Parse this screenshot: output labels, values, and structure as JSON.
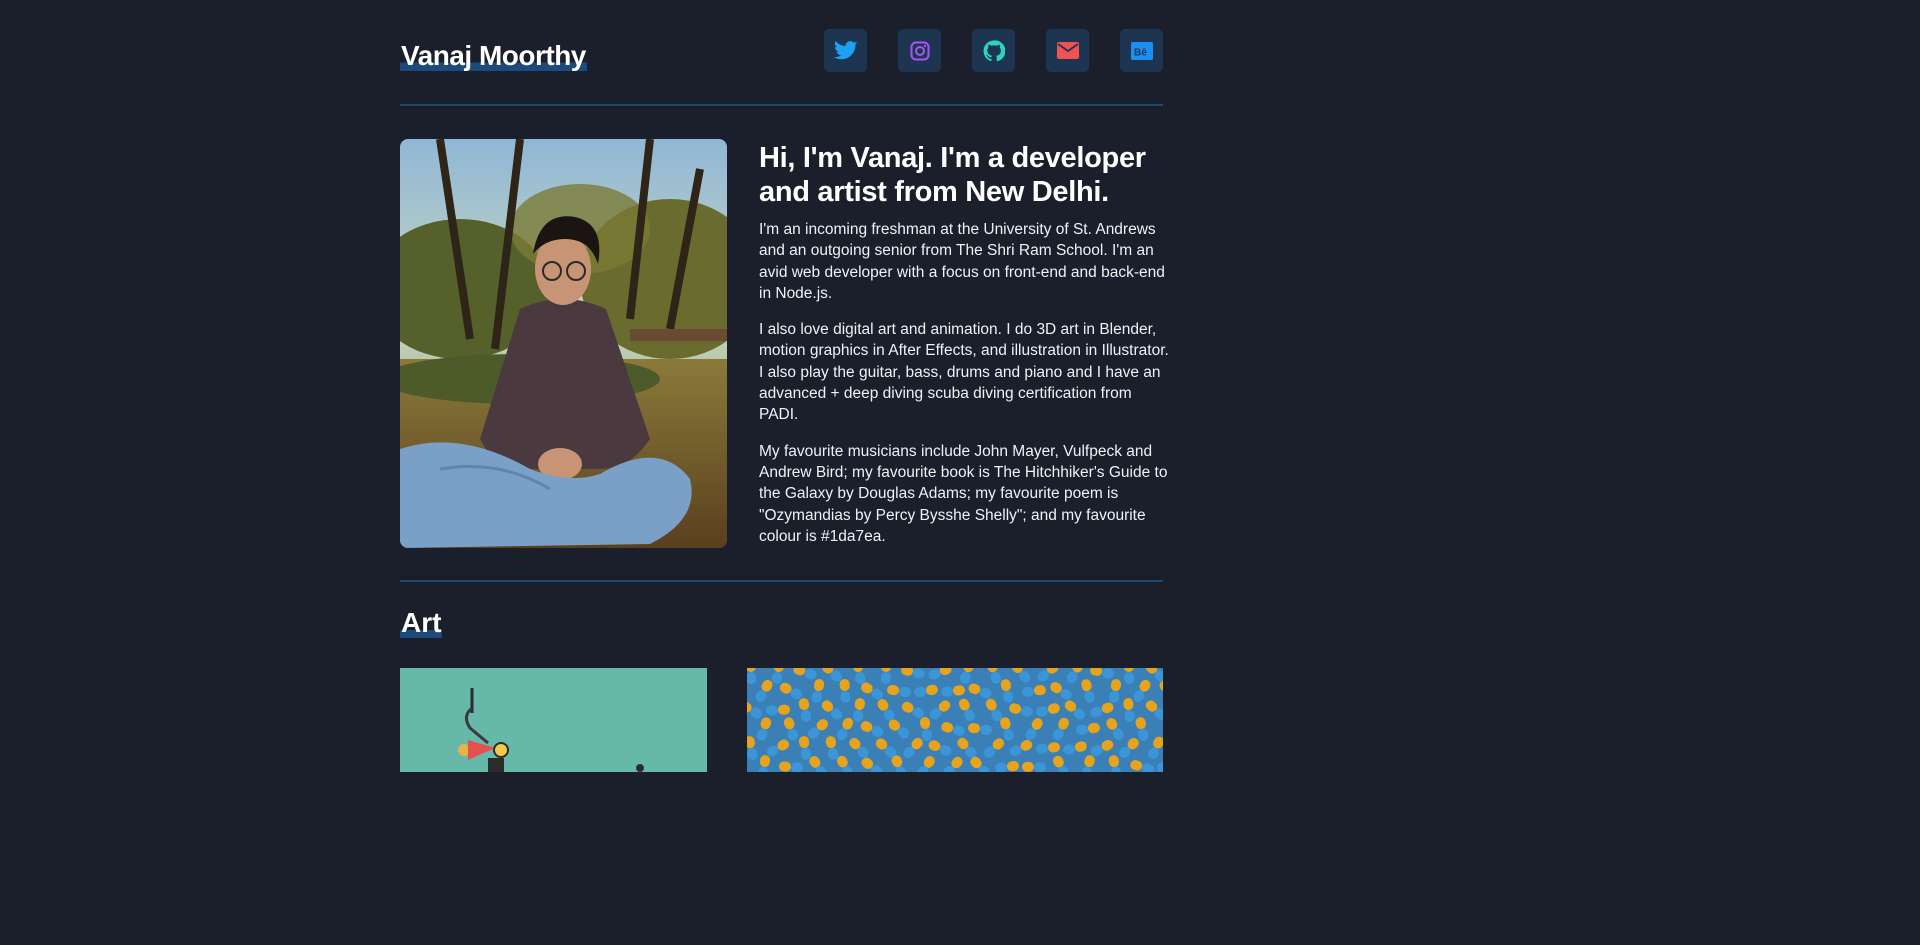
{
  "site": {
    "title": "Vanaj Moorthy"
  },
  "socials": [
    {
      "name": "twitter",
      "icon": "twitter-icon",
      "color": "#1da1f2"
    },
    {
      "name": "instagram",
      "icon": "instagram-icon",
      "color": "#a855f7"
    },
    {
      "name": "github",
      "icon": "github-icon",
      "color": "#2dd4bf"
    },
    {
      "name": "email",
      "icon": "envelope-icon",
      "color": "#f05252"
    },
    {
      "name": "behance",
      "icon": "behance-icon",
      "color": "#1d8ff0"
    }
  ],
  "about": {
    "heading": "Hi, I'm Vanaj. I'm a developer and artist from New Delhi.",
    "paragraphs": [
      "I'm an incoming freshman at the University of St. Andrews and an outgoing senior from The Shri Ram School. I'm an avid web developer with a focus on front-end and back-end in Node.js.",
      "I also love digital art and animation. I do 3D art in Blender, motion graphics in After Effects, and illustration in Illustrator. I also play the guitar, bass, drums and piano and I have an advanced + deep diving scuba diving certification from PADI.",
      "My favourite musicians include John Mayer, Vulfpeck and Andrew Bird; my favourite book is The Hitchhiker's Guide to the Galaxy by Douglas Adams; my favourite poem is \"Ozymandias by Percy Bysshe Shelly\"; and my favourite colour is #1da7ea."
    ]
  },
  "art": {
    "title": "Art"
  },
  "colors": {
    "background": "#1a1f2b",
    "divider": "#1d4870",
    "button_bg": "#1d3550",
    "accent": "#1da7ea"
  }
}
